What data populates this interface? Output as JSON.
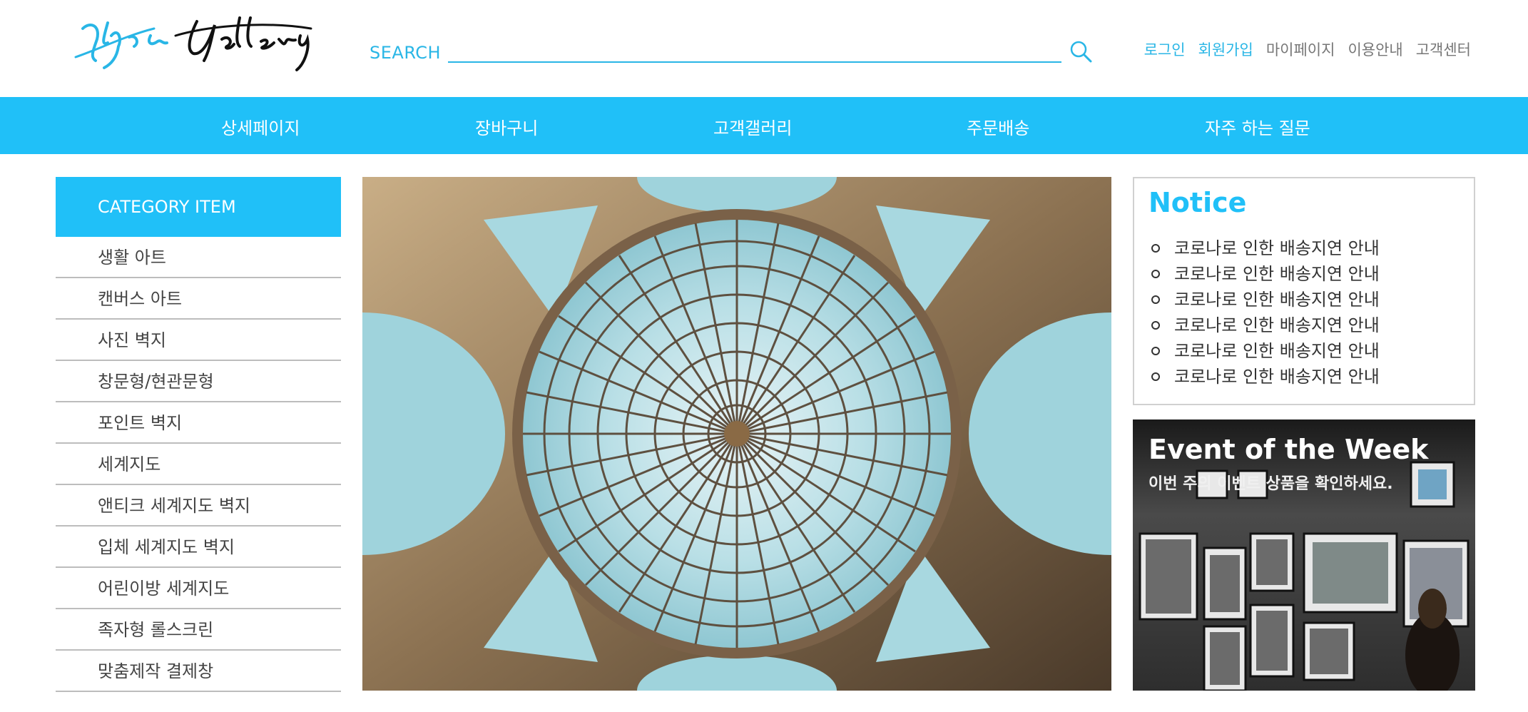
{
  "header": {
    "logo_text": "Yujin Gallery",
    "search": {
      "label": "SEARCH",
      "value": "",
      "placeholder": ""
    },
    "util_links": [
      "로그인",
      "회원가입",
      "마이페이지",
      "이용안내",
      "고객센터"
    ]
  },
  "nav": {
    "items": [
      "상세페이지",
      "장바구니",
      "고객갤러리",
      "주문배송",
      "자주 하는 질문"
    ]
  },
  "sidebar": {
    "heading": "CATEGORY ITEM",
    "items": [
      "생활 아트",
      "캔버스 아트",
      "사진 벽지",
      "창문형/현관문형",
      "포인트 벽지",
      "세계지도",
      "앤티크 세계지도 벽지",
      "입체 세계지도 벽지",
      "어린이방 세계지도",
      "족자형 롤스크린",
      "맞춤제작 결제창"
    ]
  },
  "notice": {
    "title": "Notice",
    "items": [
      "코로나로 인한 배송지연 안내",
      "코로나로 인한 배송지연 안내",
      "코로나로 인한 배송지연 안내",
      "코로나로 인한 배송지연 안내",
      "코로나로 인한 배송지연 안내",
      "코로나로 인한 배송지연 안내"
    ]
  },
  "event": {
    "title": "Event of the Week",
    "subtitle": "이번 주의 이벤트 상품을 확인하세요."
  },
  "colors": {
    "accent": "#20c0f8",
    "accent_text": "#29b6e6",
    "border": "#bdbdbd"
  }
}
